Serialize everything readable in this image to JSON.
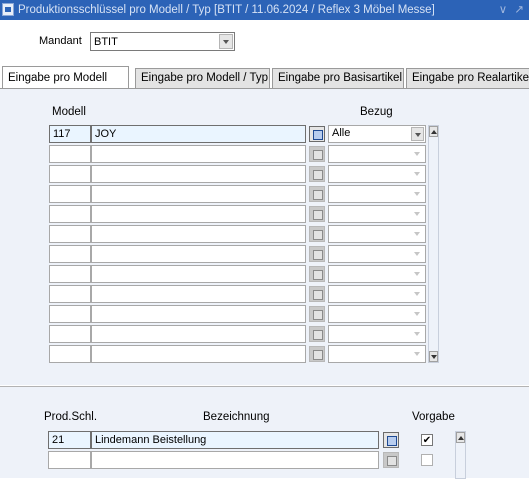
{
  "window": {
    "title": "Produktionsschlüssel pro Modell / Typ  [BTIT / 11.06.2024 / Reflex 3 Möbel Messe]",
    "controls": "∨ ↗"
  },
  "mandant": {
    "label": "Mandant",
    "value": "BTIT"
  },
  "tabs": [
    {
      "label": "Eingabe pro Modell",
      "active": true
    },
    {
      "label": "Eingabe pro Modell / Typ",
      "active": false
    },
    {
      "label": "Eingabe pro Basisartikel",
      "active": false
    },
    {
      "label": "Eingabe pro Realartike",
      "active": false
    }
  ],
  "modell_block": {
    "headers": {
      "modell": "Modell",
      "bezug": "Bezug"
    },
    "rows": [
      {
        "modell": "117",
        "bezeichnung": "JOY",
        "bezug": "Alle"
      },
      {
        "modell": "",
        "bezeichnung": "",
        "bezug": ""
      },
      {
        "modell": "",
        "bezeichnung": "",
        "bezug": ""
      },
      {
        "modell": "",
        "bezeichnung": "",
        "bezug": ""
      },
      {
        "modell": "",
        "bezeichnung": "",
        "bezug": ""
      },
      {
        "modell": "",
        "bezeichnung": "",
        "bezug": ""
      },
      {
        "modell": "",
        "bezeichnung": "",
        "bezug": ""
      },
      {
        "modell": "",
        "bezeichnung": "",
        "bezug": ""
      },
      {
        "modell": "",
        "bezeichnung": "",
        "bezug": ""
      },
      {
        "modell": "",
        "bezeichnung": "",
        "bezug": ""
      },
      {
        "modell": "",
        "bezeichnung": "",
        "bezug": ""
      },
      {
        "modell": "",
        "bezeichnung": "",
        "bezug": ""
      }
    ]
  },
  "prod_block": {
    "headers": {
      "prod_schl": "Prod.Schl.",
      "bezeichnung": "Bezeichnung",
      "vorgabe": "Vorgabe"
    },
    "rows": [
      {
        "prod_schl": "21",
        "bezeichnung": "Lindemann Beistellung",
        "vorgabe": true
      },
      {
        "prod_schl": "",
        "bezeichnung": "",
        "vorgabe": false
      }
    ]
  },
  "colors": {
    "titlebar": "#2c63b7",
    "panel": "#eef2f9",
    "current_row": "#eaf5ff"
  }
}
